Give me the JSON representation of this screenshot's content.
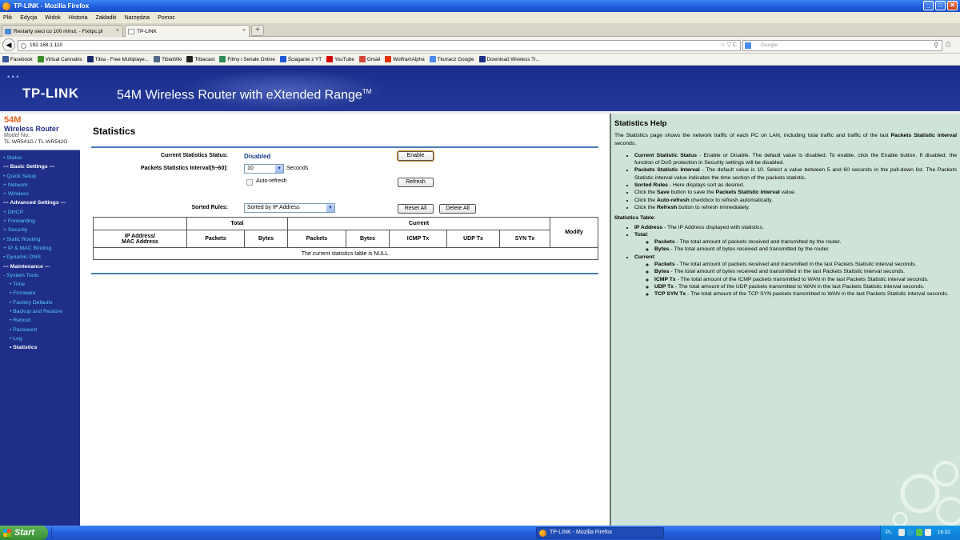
{
  "window": {
    "title": "TP-LINK - Mozilla Firefox",
    "controls": [
      "_",
      "□",
      "✕"
    ]
  },
  "menubar": [
    "Plik",
    "Edycja",
    "Widok",
    "Historia",
    "Zakładki",
    "Narzędzia",
    "Pomoc"
  ],
  "tabs": [
    {
      "label": "Restarty sieci co 100 minut. - Fixitpc.pl",
      "close": "×"
    },
    {
      "label": "TP-LINK",
      "close": "×"
    }
  ],
  "newtab": "+",
  "nav": {
    "back": "◀",
    "url": "192.168.1.110",
    "url_controls": "☆ ▽ C",
    "search_placeholder": "Google",
    "search_icon": "⚲",
    "home": "⌂"
  },
  "bookmarks": [
    {
      "label": "Facebook",
      "color": "#3b5998"
    },
    {
      "label": "Virtual Cannabis",
      "color": "#3c8d2f"
    },
    {
      "label": "Tibia - Free Multiplaye...",
      "color": "#1a2a6b"
    },
    {
      "label": "TibiaWiki",
      "color": "#556b8a"
    },
    {
      "label": "Tibiacast",
      "color": "#222222"
    },
    {
      "label": "Filmy i Seriale Online",
      "color": "#2e8b57"
    },
    {
      "label": "Ściaganie z YT",
      "color": "#1e5ad8"
    },
    {
      "label": "YouTube",
      "color": "#d00000"
    },
    {
      "label": "Gmail",
      "color": "#d44638"
    },
    {
      "label": "WolframAlpha",
      "color": "#dd3300"
    },
    {
      "label": "Tłumacz Google",
      "color": "#4a8bf0"
    },
    {
      "label": "Download Wireless Tr...",
      "color": "#1f2e88"
    }
  ],
  "header": {
    "logo": "TP-LINK",
    "logo_dots": "• • •",
    "product": "54M Wireless Router with eXtended Range",
    "tm": "TM"
  },
  "sidebar": {
    "model_54": "54M",
    "model_title": "Wireless Router",
    "model_no_label": "Model No.:",
    "model_id": "TL-WR541G / TL-WR542G",
    "items": [
      {
        "label": "• Status",
        "kind": "item"
      },
      {
        "label": "--- Basic Settings ---",
        "kind": "hdr"
      },
      {
        "label": "• Quick Setup",
        "kind": "item"
      },
      {
        "label": "+ Network",
        "kind": "item"
      },
      {
        "label": "+ Wireless",
        "kind": "item"
      },
      {
        "label": "--- Advanced Settings ---",
        "kind": "hdr"
      },
      {
        "label": "+ DHCP",
        "kind": "item"
      },
      {
        "label": "+ Forwarding",
        "kind": "item"
      },
      {
        "label": "+ Security",
        "kind": "item"
      },
      {
        "label": "• Static Routing",
        "kind": "item"
      },
      {
        "label": "+ IP & MAC Binding",
        "kind": "item"
      },
      {
        "label": "• Dynamic DNS",
        "kind": "item"
      },
      {
        "label": "--- Maintenance ---",
        "kind": "hdr"
      },
      {
        "label": "- System Tools",
        "kind": "item"
      },
      {
        "label": "• Time",
        "kind": "sub"
      },
      {
        "label": "• Firmware",
        "kind": "sub"
      },
      {
        "label": "• Factory Defaults",
        "kind": "sub"
      },
      {
        "label": "• Backup and Restore",
        "kind": "sub"
      },
      {
        "label": "• Reboot",
        "kind": "sub"
      },
      {
        "label": "• Password",
        "kind": "sub"
      },
      {
        "label": "• Log",
        "kind": "sub"
      },
      {
        "label": "• Statistics",
        "kind": "cur"
      }
    ]
  },
  "main": {
    "title": "Statistics",
    "status_label": "Current Statistics Status:",
    "status_value": "Disabled",
    "enable_button": "Enable",
    "interval_label": "Packets Statistics Interval(5~60):",
    "interval_value": "10",
    "interval_unit": "Seconds",
    "autorefresh_label": "Auto-refresh",
    "refresh_button": "Refresh",
    "sorted_label": "Sorted Rules:",
    "sorted_value": "Sorted by IP Address",
    "reset_all_button": "Reset All",
    "delete_all_button": "Delete All",
    "dropdown_arrow": "▼",
    "table": {
      "group_total": "Total",
      "group_current": "Current",
      "modify": "Modify",
      "ip_mac": "IP Address/\nMAC Address",
      "columns": [
        "Packets",
        "Bytes",
        "Packets",
        "Bytes",
        "ICMP Tx",
        "UDP Tx",
        "SYN Tx"
      ],
      "empty": "The current statistics table is NULL."
    }
  },
  "help": {
    "title": "Statistics Help",
    "intro_a": "The Statistics page shows the network traffic of each PC on LAN, including total traffic and traffic of the last ",
    "intro_b": "Packets Statistic interval",
    "intro_c": " seconds.",
    "items": [
      {
        "b": "Current Statistic Status",
        "t": " - Enable or Disable. The default value is disabled. To enable, click the Enable button. If disabled, the function of DoS protection in Security settings will be disabled."
      },
      {
        "b": "Packets Statistic Interval",
        "t": " - The default value is 10. Select a value between 5 and 60 seconds in the pull-down list. The Packets Statistic interval value indicates the time section of the packets statistic."
      },
      {
        "b": "Sorted Rules",
        "t": " - Here displays sort as desired."
      }
    ],
    "save_a": "Click the ",
    "save_b": "Save",
    "save_c": " button to save the ",
    "save_d": "Packets Statistic interval",
    "save_e": " value.",
    "auto_a": "Click the ",
    "auto_b": "Auto-refresh",
    "auto_c": " checkbox to refresh automatically.",
    "ref_a": "Click the ",
    "ref_b": "Refresh",
    "ref_c": " button to refresh immediately.",
    "table_title": "Statistics Table",
    "table_colon": ":",
    "ip_b": "IP Address",
    "ip_t": " - The IP Address displayed with statistics.",
    "total_b": "Total",
    "total_colon": ":",
    "tot_items": [
      {
        "b": "Packets",
        "t": " - The total amount of packets received and transmitted by the router."
      },
      {
        "b": "Bytes",
        "t": " - The total amount of bytes received and transmitted by the router."
      }
    ],
    "current_b": "Current",
    "current_colon": ":",
    "cur_items": [
      {
        "b": "Packets",
        "t": " - The total amount of packets received and transmitted in the last Packets Statistic interval seconds."
      },
      {
        "b": "Bytes",
        "t": " - The total amount of bytes received and transmitted in the last Packets Statistic interval seconds."
      },
      {
        "b": "ICMP Tx",
        "t": " - The total amount of the ICMP packets transmitted to WAN in the last Packets Statistic interval seconds."
      },
      {
        "b": "UDP Tx",
        "t": " - The total amount of the UDP packets transmitted to WAN in the last Packets Statistic interval seconds."
      },
      {
        "b": "TCP SYN Tx",
        "t": " - The total amount of the TCP SYN packets transmitted to WAN in the last Packets Statistic interval seconds."
      }
    ]
  },
  "taskbar": {
    "start": "Start",
    "task": "TP-LINK - Mozilla Firefox",
    "lang": "PL",
    "time": "16:32"
  }
}
